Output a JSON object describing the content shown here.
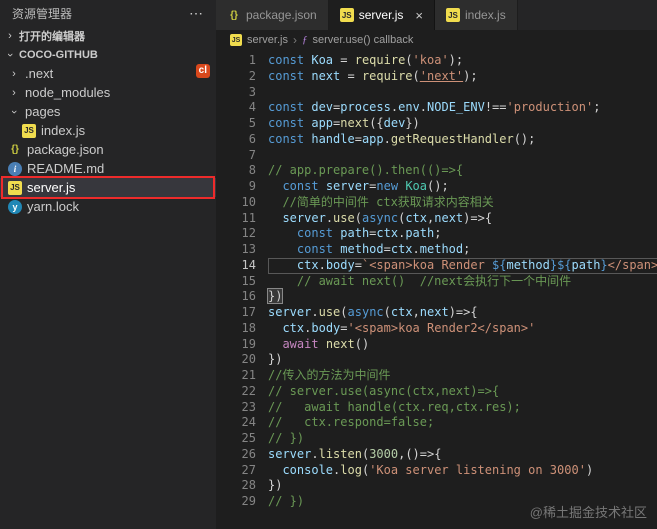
{
  "icons": {
    "js": "JS",
    "json": "{}",
    "md": "i",
    "lock": "y",
    "chevron": "›",
    "close": "×",
    "more": "⋯",
    "symbol": "ƒ"
  },
  "sidebar": {
    "title": "资源管理器",
    "open_editors": "打开的编辑器",
    "workspace": "COCO-GITHUB",
    "badge": "cl",
    "files": [
      {
        "label": ".next",
        "kind": "folder",
        "chevron": "collapsed",
        "indent": 0
      },
      {
        "label": "node_modules",
        "kind": "folder",
        "chevron": "collapsed",
        "indent": 0
      },
      {
        "label": "pages",
        "kind": "folder",
        "chevron": "expanded",
        "indent": 0
      },
      {
        "label": "index.js",
        "kind": "js",
        "indent": 1
      },
      {
        "label": "package.json",
        "kind": "json",
        "indent": 0
      },
      {
        "label": "README.md",
        "kind": "md",
        "indent": 0
      },
      {
        "label": "server.js",
        "kind": "js",
        "indent": 0,
        "selected": true,
        "annotated": true
      },
      {
        "label": "yarn.lock",
        "kind": "lock",
        "indent": 0
      }
    ]
  },
  "tabs": [
    {
      "label": "package.json",
      "kind": "json",
      "active": false
    },
    {
      "label": "server.js",
      "kind": "js",
      "active": true
    },
    {
      "label": "index.js",
      "kind": "js",
      "active": false
    }
  ],
  "breadcrumb": {
    "file": "server.js",
    "separator": "›",
    "symbol": "server.use() callback"
  },
  "watermark": "@稀土掘金技术社区",
  "editor": {
    "lines": [
      {
        "num": 1,
        "tokens": [
          {
            "t": "k",
            "s": "const "
          },
          {
            "t": "v",
            "s": "Koa"
          },
          {
            "t": "p",
            "s": " = "
          },
          {
            "t": "f",
            "s": "require"
          },
          {
            "t": "p",
            "s": "("
          },
          {
            "t": "s",
            "s": "'koa'"
          },
          {
            "t": "p",
            "s": ");"
          }
        ]
      },
      {
        "num": 2,
        "tokens": [
          {
            "t": "k",
            "s": "const "
          },
          {
            "t": "v",
            "s": "next"
          },
          {
            "t": "p",
            "s": " = "
          },
          {
            "t": "f",
            "s": "require"
          },
          {
            "t": "p",
            "s": "("
          },
          {
            "t": "su",
            "s": "'next'"
          },
          {
            "t": "p",
            "s": ");"
          }
        ]
      },
      {
        "num": 3,
        "tokens": []
      },
      {
        "num": 4,
        "tokens": [
          {
            "t": "k",
            "s": "const "
          },
          {
            "t": "v",
            "s": "dev"
          },
          {
            "t": "p",
            "s": "="
          },
          {
            "t": "v",
            "s": "process"
          },
          {
            "t": "p",
            "s": "."
          },
          {
            "t": "v",
            "s": "env"
          },
          {
            "t": "p",
            "s": "."
          },
          {
            "t": "v",
            "s": "NODE_ENV"
          },
          {
            "t": "p",
            "s": "!=="
          },
          {
            "t": "s",
            "s": "'production'"
          },
          {
            "t": "p",
            "s": ";"
          }
        ]
      },
      {
        "num": 5,
        "tokens": [
          {
            "t": "k",
            "s": "const "
          },
          {
            "t": "v",
            "s": "app"
          },
          {
            "t": "p",
            "s": "="
          },
          {
            "t": "f",
            "s": "next"
          },
          {
            "t": "p",
            "s": "({"
          },
          {
            "t": "v",
            "s": "dev"
          },
          {
            "t": "p",
            "s": "})"
          }
        ]
      },
      {
        "num": 6,
        "tokens": [
          {
            "t": "k",
            "s": "const "
          },
          {
            "t": "v",
            "s": "handle"
          },
          {
            "t": "p",
            "s": "="
          },
          {
            "t": "v",
            "s": "app"
          },
          {
            "t": "p",
            "s": "."
          },
          {
            "t": "f",
            "s": "getRequestHandler"
          },
          {
            "t": "p",
            "s": "();"
          }
        ]
      },
      {
        "num": 7,
        "tokens": []
      },
      {
        "num": 8,
        "tokens": [
          {
            "t": "c",
            "s": "// app.prepare().then(()=>{"
          }
        ]
      },
      {
        "num": 9,
        "tokens": [
          {
            "t": "p",
            "s": "  "
          },
          {
            "t": "k",
            "s": "const "
          },
          {
            "t": "v",
            "s": "server"
          },
          {
            "t": "p",
            "s": "="
          },
          {
            "t": "k",
            "s": "new "
          },
          {
            "t": "cl",
            "s": "Koa"
          },
          {
            "t": "p",
            "s": "();"
          }
        ]
      },
      {
        "num": 10,
        "tokens": [
          {
            "t": "p",
            "s": "  "
          },
          {
            "t": "c",
            "s": "//简单的中间件 ctx获取请求内容相关"
          }
        ]
      },
      {
        "num": 11,
        "tokens": [
          {
            "t": "p",
            "s": "  "
          },
          {
            "t": "v",
            "s": "server"
          },
          {
            "t": "p",
            "s": "."
          },
          {
            "t": "f",
            "s": "use"
          },
          {
            "t": "p",
            "s": "("
          },
          {
            "t": "k",
            "s": "async"
          },
          {
            "t": "p",
            "s": "("
          },
          {
            "t": "v",
            "s": "ctx"
          },
          {
            "t": "p",
            "s": ","
          },
          {
            "t": "v",
            "s": "next"
          },
          {
            "t": "p",
            "s": ")=>{"
          }
        ]
      },
      {
        "num": 12,
        "tokens": [
          {
            "t": "p",
            "s": "    "
          },
          {
            "t": "k",
            "s": "const "
          },
          {
            "t": "v",
            "s": "path"
          },
          {
            "t": "p",
            "s": "="
          },
          {
            "t": "v",
            "s": "ctx"
          },
          {
            "t": "p",
            "s": "."
          },
          {
            "t": "v",
            "s": "path"
          },
          {
            "t": "p",
            "s": ";"
          }
        ]
      },
      {
        "num": 13,
        "tokens": [
          {
            "t": "p",
            "s": "    "
          },
          {
            "t": "k",
            "s": "const "
          },
          {
            "t": "v",
            "s": "method"
          },
          {
            "t": "p",
            "s": "="
          },
          {
            "t": "v",
            "s": "ctx"
          },
          {
            "t": "p",
            "s": "."
          },
          {
            "t": "v",
            "s": "method"
          },
          {
            "t": "p",
            "s": ";"
          }
        ]
      },
      {
        "num": 14,
        "current": true,
        "tokens": [
          {
            "t": "p",
            "s": "    "
          },
          {
            "t": "v",
            "s": "ctx"
          },
          {
            "t": "p",
            "s": "."
          },
          {
            "t": "v",
            "s": "body"
          },
          {
            "t": "p",
            "s": "="
          },
          {
            "t": "s",
            "s": "`<span>koa Render "
          },
          {
            "t": "d",
            "s": "${"
          },
          {
            "t": "v",
            "s": "method"
          },
          {
            "t": "d",
            "s": "}"
          },
          {
            "t": "d",
            "s": "${"
          },
          {
            "t": "v",
            "s": "path"
          },
          {
            "t": "d",
            "s": "}"
          },
          {
            "t": "s",
            "s": "</span>`"
          }
        ]
      },
      {
        "num": 15,
        "tokens": [
          {
            "t": "p",
            "s": "    "
          },
          {
            "t": "c",
            "s": "// await next()  //next会执行下一个中间件"
          }
        ]
      },
      {
        "num": 16,
        "tokens": [
          {
            "t": "hl",
            "s": "})"
          }
        ]
      },
      {
        "num": 17,
        "tokens": [
          {
            "t": "v",
            "s": "server"
          },
          {
            "t": "p",
            "s": "."
          },
          {
            "t": "f",
            "s": "use"
          },
          {
            "t": "p",
            "s": "("
          },
          {
            "t": "k",
            "s": "async"
          },
          {
            "t": "p",
            "s": "("
          },
          {
            "t": "v",
            "s": "ctx"
          },
          {
            "t": "p",
            "s": ","
          },
          {
            "t": "v",
            "s": "next"
          },
          {
            "t": "p",
            "s": ")=>{"
          }
        ]
      },
      {
        "num": 18,
        "tokens": [
          {
            "t": "p",
            "s": "  "
          },
          {
            "t": "v",
            "s": "ctx"
          },
          {
            "t": "p",
            "s": "."
          },
          {
            "t": "v",
            "s": "body"
          },
          {
            "t": "p",
            "s": "="
          },
          {
            "t": "s",
            "s": "'<spam>koa Render2</span>'"
          }
        ]
      },
      {
        "num": 19,
        "tokens": [
          {
            "t": "p",
            "s": "  "
          },
          {
            "t": "aw",
            "s": "await "
          },
          {
            "t": "f",
            "s": "next"
          },
          {
            "t": "p",
            "s": "()"
          }
        ]
      },
      {
        "num": 20,
        "tokens": [
          {
            "t": "p",
            "s": "})"
          }
        ]
      },
      {
        "num": 21,
        "tokens": [
          {
            "t": "c",
            "s": "//传入的方法为中间件"
          }
        ]
      },
      {
        "num": 22,
        "tokens": [
          {
            "t": "c",
            "s": "// server.use(async(ctx,next)=>{"
          }
        ]
      },
      {
        "num": 23,
        "tokens": [
          {
            "t": "c",
            "s": "//   await handle(ctx.req,ctx.res);"
          }
        ]
      },
      {
        "num": 24,
        "tokens": [
          {
            "t": "c",
            "s": "//   ctx.respond=false;"
          }
        ]
      },
      {
        "num": 25,
        "tokens": [
          {
            "t": "c",
            "s": "// })"
          }
        ]
      },
      {
        "num": 26,
        "tokens": [
          {
            "t": "v",
            "s": "server"
          },
          {
            "t": "p",
            "s": "."
          },
          {
            "t": "f",
            "s": "listen"
          },
          {
            "t": "p",
            "s": "("
          },
          {
            "t": "n",
            "s": "3000"
          },
          {
            "t": "p",
            "s": ",()=>{"
          }
        ]
      },
      {
        "num": 27,
        "tokens": [
          {
            "t": "p",
            "s": "  "
          },
          {
            "t": "v",
            "s": "console"
          },
          {
            "t": "p",
            "s": "."
          },
          {
            "t": "f",
            "s": "log"
          },
          {
            "t": "p",
            "s": "("
          },
          {
            "t": "s",
            "s": "'Koa server listening on 3000'"
          },
          {
            "t": "p",
            "s": ")"
          }
        ]
      },
      {
        "num": 28,
        "tokens": [
          {
            "t": "p",
            "s": "})"
          }
        ]
      },
      {
        "num": 29,
        "tokens": [
          {
            "t": "c",
            "s": "// })"
          }
        ]
      }
    ]
  }
}
